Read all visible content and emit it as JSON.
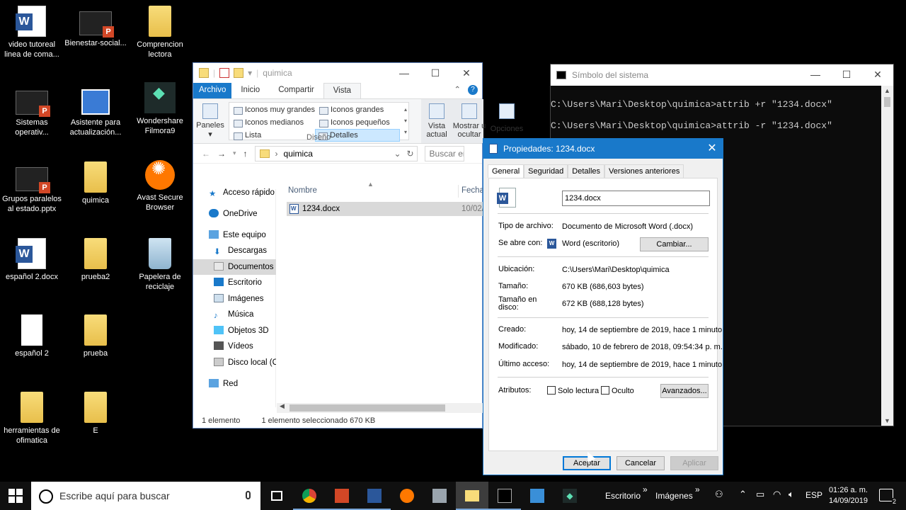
{
  "desktop": {
    "icons": [
      {
        "label": "video tutoreal linea de coma...",
        "icon": "word-doc-icon"
      },
      {
        "label": "Bienestar-social...",
        "icon": "powerpoint-icon"
      },
      {
        "label": "Comprencion lectora",
        "icon": "folder-icon"
      },
      {
        "label": "Sistemas operativ...",
        "icon": "powerpoint-icon"
      },
      {
        "label": "Asistente para actualización...",
        "icon": "update-assistant-icon"
      },
      {
        "label": "Wondershare Filmora9",
        "icon": "filmora-icon"
      },
      {
        "label": "Grupos paralelos al estado.pptx",
        "icon": "powerpoint-icon"
      },
      {
        "label": "quimica",
        "icon": "folder-icon"
      },
      {
        "label": "Avast Secure Browser",
        "icon": "avast-icon"
      },
      {
        "label": "español 2.docx",
        "icon": "word-doc-icon"
      },
      {
        "label": "prueba2",
        "icon": "folder-icon"
      },
      {
        "label": "Papelera de reciclaje",
        "icon": "recycle-bin-icon"
      },
      {
        "label": "español 2",
        "icon": "blank-file-icon"
      },
      {
        "label": "prueba",
        "icon": "folder-icon"
      },
      {
        "label": "herramientas de ofimatica",
        "icon": "folder-icon"
      },
      {
        "label": "E",
        "icon": "folder-icon"
      }
    ]
  },
  "explorer": {
    "title": "quimica",
    "tabs": [
      "Archivo",
      "Inicio",
      "Compartir",
      "Vista"
    ],
    "active_tab": "Vista",
    "ribbon": {
      "paneles": "Paneles",
      "layouts": [
        "Iconos muy grandes",
        "Iconos grandes",
        "Iconos medianos",
        "Iconos pequeños",
        "Lista",
        "Detalles"
      ],
      "selected_layout": "Detalles",
      "group_label": "Diseño",
      "vista_actual": "Vista actual",
      "mostrar_ocultar": "Mostrar u ocultar",
      "opciones": "Opciones"
    },
    "address": "quimica",
    "search_placeholder": "Buscar en",
    "nav": [
      "Acceso rápido",
      "OneDrive",
      "Este equipo",
      "Descargas",
      "Documentos",
      "Escritorio",
      "Imágenes",
      "Música",
      "Objetos 3D",
      "Vídeos",
      "Disco local (C",
      "Red"
    ],
    "nav_selected": "Documentos",
    "columns": {
      "name": "Nombre",
      "date": "Fecha"
    },
    "file": {
      "name": "1234.docx",
      "date": "10/02/"
    },
    "status_count": "1 elemento",
    "status_selected": "1 elemento seleccionado  670 KB"
  },
  "cmd": {
    "title": "Símbolo del sistema",
    "lines": [
      "C:\\Users\\Mari\\Desktop\\quimica>attrib +r \"1234.docx\"",
      "C:\\Users\\Mari\\Desktop\\quimica>attrib -r \"1234.docx\""
    ]
  },
  "props": {
    "title": "Propiedades: 1234.docx",
    "tabs": [
      "General",
      "Seguridad",
      "Detalles",
      "Versiones anteriores"
    ],
    "filename": "1234.docx",
    "tipo_label": "Tipo de archivo:",
    "tipo_value": "Documento de Microsoft Word (.docx)",
    "abre_label": "Se abre con:",
    "abre_value": "Word (escritorio)",
    "cambiar": "Cambiar...",
    "ubicacion_label": "Ubicación:",
    "ubicacion_value": "C:\\Users\\Mari\\Desktop\\quimica",
    "tamano_label": "Tamaño:",
    "tamano_value": "670 KB (686,603 bytes)",
    "tamano_disco_label": "Tamaño en disco:",
    "tamano_disco_value": "672 KB (688,128 bytes)",
    "creado_label": "Creado:",
    "creado_value": "hoy, 14 de septiembre de 2019, hace 1 minuto",
    "modificado_label": "Modificado:",
    "modificado_value": "sábado, 10 de febrero de 2018, 09:54:34 p. m.",
    "acceso_label": "Último acceso:",
    "acceso_value": "hoy, 14 de septiembre de 2019, hace 1 minuto",
    "atributos_label": "Atributos:",
    "solo_lectura": "Solo lectura",
    "oculto": "Oculto",
    "avanzados": "Avanzados...",
    "aceptar": "Aceptar",
    "cancelar": "Cancelar",
    "aplicar": "Aplicar"
  },
  "taskbar": {
    "search_placeholder": "Escribe aquí para buscar",
    "toolbar_escritorio": "Escritorio",
    "toolbar_imagenes": "Imágenes",
    "language": "ESP",
    "time": "01:26 a. m.",
    "date": "14/09/2019",
    "notifications": "2"
  }
}
